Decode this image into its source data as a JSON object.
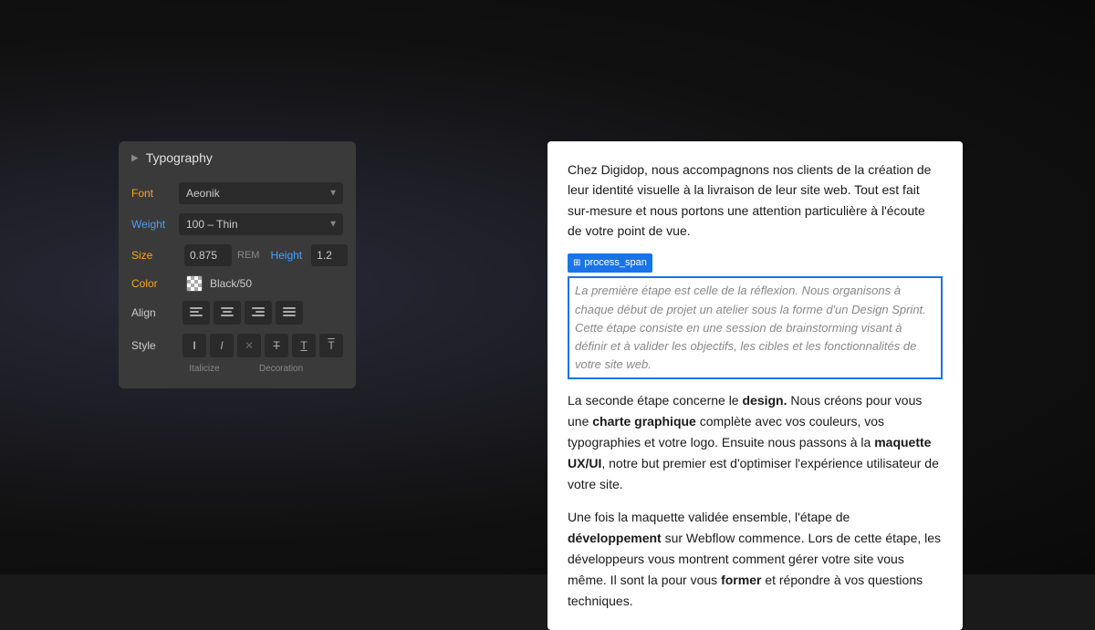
{
  "panel": {
    "title": "Typography",
    "arrow": "▶",
    "rows": {
      "font": {
        "label": "Font",
        "value": "Aeonik"
      },
      "weight": {
        "label": "Weight",
        "value": "100 – Thin"
      },
      "size": {
        "label": "Size",
        "value": "0.875",
        "unit": "REM",
        "height_label": "Height",
        "height_value": "1.2",
        "dash": "–"
      },
      "color": {
        "label": "Color",
        "value": "Black/50"
      },
      "align": {
        "label": "Align",
        "buttons": [
          "≡",
          "≡",
          "≡",
          "≡"
        ]
      },
      "style": {
        "label": "Style",
        "buttons": [
          "I",
          "I",
          "✕",
          "T̶",
          "T̲",
          "T̄"
        ],
        "sublabels": [
          "Italicize",
          "Decoration"
        ]
      }
    }
  },
  "preview": {
    "text1": "Chez Digidop, nous accompagnons nos clients de la création de leur identité visuelle à la livraison de leur site web. Tout est fait sur-mesure et nous portons une attention particulière à l'écoute de votre point de vue.",
    "span_tag": "process_span",
    "selected_text": "La première étape est celle de la réflexion. Nous organisons à chaque début de projet un atelier sous la forme d'un Design Sprint. Cette étape consiste en une session de brainstorming visant à définir et à valider les objectifs, les cibles et les fonctionnalités de votre site web.",
    "text2_parts": [
      "La seconde étape concerne le ",
      "design",
      ". Nous créons pour vous une ",
      "charte graphique",
      " complète avec vos couleurs, vos typographies et votre logo. Ensuite nous passons à la ",
      "maquette UX/UI",
      ", notre but premier est d'optimiser l'expérience utilisateur de votre site."
    ],
    "text3_parts": [
      "Une fois la maquette validée ensemble, l'étape de ",
      "développement",
      " sur Webflow commence. Lors de cette étape, les développeurs vous montrent comment gérer votre site vous même. Il sont la pour vous ",
      "former",
      " et répondre à vos questions techniques."
    ]
  }
}
